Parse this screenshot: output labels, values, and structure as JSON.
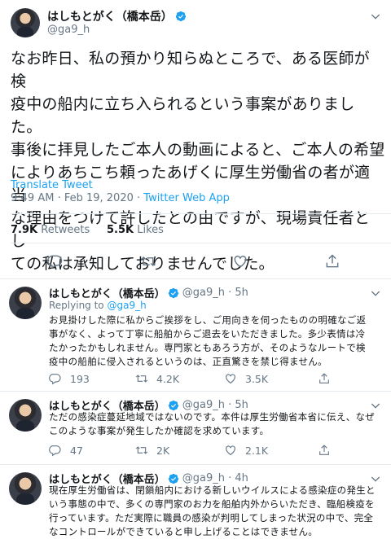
{
  "main_tweet": {
    "display_name": "はしもとがく（橋本岳）",
    "handle": "@ga9_h",
    "text_lines": [
      "なお昨日、私の預かり知らぬところで、ある医師が検",
      "疫中の船内に立ち入られるという事案がありました。",
      "事後に拝見したご本人の動画によると、ご本人の希望",
      "によりあちこち頼ったあげくに厚生労働省の者が適当",
      "な理由をつけて許したとの由ですが、現場責任者とし",
      "ての私は承知しておりませんでした。"
    ],
    "translate": "Translate Tweet",
    "time": "9:49 AM · Feb 19, 2020 · ",
    "source_app": "Twitter Web App",
    "retweets_count": "7.9K",
    "retweets_label": " Retweets",
    "likes_count": "5.5K",
    "likes_label": " Likes",
    "accent_color": "#1da1f2"
  },
  "replies": [
    {
      "display_name": "はしもとがく（橋本岳）",
      "handle": "@ga9_h · 5h",
      "replying_prefix": "Replying to ",
      "replying_handle": "@ga9_h",
      "text_lines": [
        "お見掛けした際に私からご挨拶をし、ご用向きを伺ったものの明確なご返",
        "事がなく、よって丁寧に船舶からご退去をいただきました。多少表情は冷",
        "たかったかもしれません。専門家ともあろう方が、そのようなルートで検",
        "疫中の船舶に侵入されるというのは、正直驚きを禁じ得ません。"
      ],
      "replies": "193",
      "retweets": "4.2K",
      "likes": "3.5K"
    },
    {
      "display_name": "はしもとがく（橋本岳）",
      "handle": "@ga9_h · 5h",
      "text_lines": [
        "ただの感染症蔓延地域ではないのです。本件は厚生労働省本省に伝え、なぜ",
        "このような事案が発生したか確認を求めています。"
      ],
      "replies": "47",
      "retweets": "2K",
      "likes": "2.1K"
    },
    {
      "display_name": "はしもとがく（橋本岳）",
      "handle": "@ga9_h · 4h",
      "text_lines": [
        "現在厚生労働省は、閉鎖船内における新しいウイルスによる感染症の発生と",
        "いう事態の中で、多くの専門家のお力を船舶内外からいただき、臨船検疫を",
        "行っています。ただ実際に職員の感染が判明してしまった状況の中で、完全",
        "なコントロールができていると申し上げることはできません。"
      ]
    }
  ],
  "icons": [
    "verified-badge-icon",
    "chevron-down-icon",
    "reply-icon",
    "retweet-icon",
    "like-icon",
    "share-icon"
  ]
}
